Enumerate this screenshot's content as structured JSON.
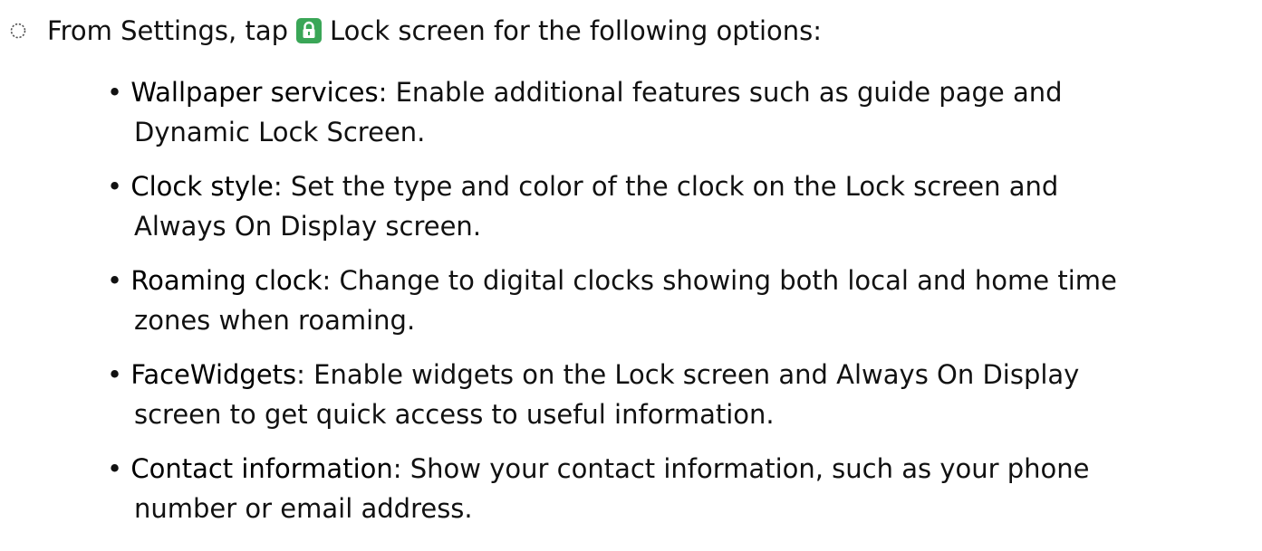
{
  "intro": {
    "prefix": "From Settings, tap",
    "highlight": "Lock screen",
    "suffix": "for the following options:",
    "step_icon": "dashed-circle-icon",
    "lock_icon": "lock-icon",
    "lock_icon_color": "#3aa657"
  },
  "bullets": [
    {
      "term": "Wallpaper services",
      "desc_line1": ": Enable additional features such as guide page and",
      "desc_line2": "Dynamic Lock Screen."
    },
    {
      "term": "Clock style",
      "desc_line1": ": Set the type and color of the clock on the Lock screen and",
      "desc_line2": "Always On Display screen."
    },
    {
      "term": "Roaming clock",
      "desc_line1": ": Change to digital clocks showing both local and home time",
      "desc_line2": "zones when roaming."
    },
    {
      "term": "FaceWidgets",
      "desc_line1": ": Enable widgets on the Lock screen and Always On Display",
      "desc_line2": "screen to get quick access to useful information."
    },
    {
      "term": "Contact information",
      "desc_line1": ": Show your contact information, such as your phone",
      "desc_line2": "number or email address."
    }
  ]
}
